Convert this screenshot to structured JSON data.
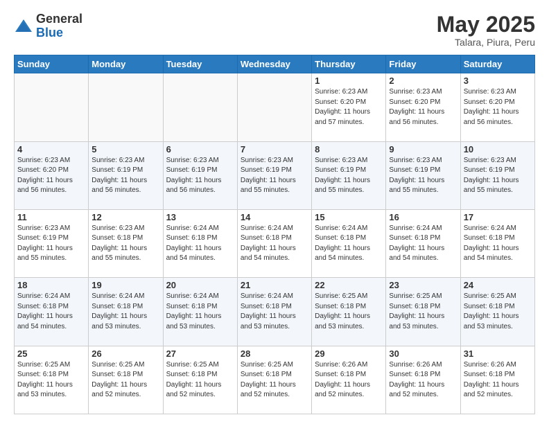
{
  "header": {
    "logo_general": "General",
    "logo_blue": "Blue",
    "month": "May 2025",
    "location": "Talara, Piura, Peru"
  },
  "days_of_week": [
    "Sunday",
    "Monday",
    "Tuesday",
    "Wednesday",
    "Thursday",
    "Friday",
    "Saturday"
  ],
  "weeks": [
    [
      {
        "day": "",
        "info": ""
      },
      {
        "day": "",
        "info": ""
      },
      {
        "day": "",
        "info": ""
      },
      {
        "day": "",
        "info": ""
      },
      {
        "day": "1",
        "info": "Sunrise: 6:23 AM\nSunset: 6:20 PM\nDaylight: 11 hours\nand 57 minutes."
      },
      {
        "day": "2",
        "info": "Sunrise: 6:23 AM\nSunset: 6:20 PM\nDaylight: 11 hours\nand 56 minutes."
      },
      {
        "day": "3",
        "info": "Sunrise: 6:23 AM\nSunset: 6:20 PM\nDaylight: 11 hours\nand 56 minutes."
      }
    ],
    [
      {
        "day": "4",
        "info": "Sunrise: 6:23 AM\nSunset: 6:20 PM\nDaylight: 11 hours\nand 56 minutes."
      },
      {
        "day": "5",
        "info": "Sunrise: 6:23 AM\nSunset: 6:19 PM\nDaylight: 11 hours\nand 56 minutes."
      },
      {
        "day": "6",
        "info": "Sunrise: 6:23 AM\nSunset: 6:19 PM\nDaylight: 11 hours\nand 56 minutes."
      },
      {
        "day": "7",
        "info": "Sunrise: 6:23 AM\nSunset: 6:19 PM\nDaylight: 11 hours\nand 55 minutes."
      },
      {
        "day": "8",
        "info": "Sunrise: 6:23 AM\nSunset: 6:19 PM\nDaylight: 11 hours\nand 55 minutes."
      },
      {
        "day": "9",
        "info": "Sunrise: 6:23 AM\nSunset: 6:19 PM\nDaylight: 11 hours\nand 55 minutes."
      },
      {
        "day": "10",
        "info": "Sunrise: 6:23 AM\nSunset: 6:19 PM\nDaylight: 11 hours\nand 55 minutes."
      }
    ],
    [
      {
        "day": "11",
        "info": "Sunrise: 6:23 AM\nSunset: 6:19 PM\nDaylight: 11 hours\nand 55 minutes."
      },
      {
        "day": "12",
        "info": "Sunrise: 6:23 AM\nSunset: 6:18 PM\nDaylight: 11 hours\nand 55 minutes."
      },
      {
        "day": "13",
        "info": "Sunrise: 6:24 AM\nSunset: 6:18 PM\nDaylight: 11 hours\nand 54 minutes."
      },
      {
        "day": "14",
        "info": "Sunrise: 6:24 AM\nSunset: 6:18 PM\nDaylight: 11 hours\nand 54 minutes."
      },
      {
        "day": "15",
        "info": "Sunrise: 6:24 AM\nSunset: 6:18 PM\nDaylight: 11 hours\nand 54 minutes."
      },
      {
        "day": "16",
        "info": "Sunrise: 6:24 AM\nSunset: 6:18 PM\nDaylight: 11 hours\nand 54 minutes."
      },
      {
        "day": "17",
        "info": "Sunrise: 6:24 AM\nSunset: 6:18 PM\nDaylight: 11 hours\nand 54 minutes."
      }
    ],
    [
      {
        "day": "18",
        "info": "Sunrise: 6:24 AM\nSunset: 6:18 PM\nDaylight: 11 hours\nand 54 minutes."
      },
      {
        "day": "19",
        "info": "Sunrise: 6:24 AM\nSunset: 6:18 PM\nDaylight: 11 hours\nand 53 minutes."
      },
      {
        "day": "20",
        "info": "Sunrise: 6:24 AM\nSunset: 6:18 PM\nDaylight: 11 hours\nand 53 minutes."
      },
      {
        "day": "21",
        "info": "Sunrise: 6:24 AM\nSunset: 6:18 PM\nDaylight: 11 hours\nand 53 minutes."
      },
      {
        "day": "22",
        "info": "Sunrise: 6:25 AM\nSunset: 6:18 PM\nDaylight: 11 hours\nand 53 minutes."
      },
      {
        "day": "23",
        "info": "Sunrise: 6:25 AM\nSunset: 6:18 PM\nDaylight: 11 hours\nand 53 minutes."
      },
      {
        "day": "24",
        "info": "Sunrise: 6:25 AM\nSunset: 6:18 PM\nDaylight: 11 hours\nand 53 minutes."
      }
    ],
    [
      {
        "day": "25",
        "info": "Sunrise: 6:25 AM\nSunset: 6:18 PM\nDaylight: 11 hours\nand 53 minutes."
      },
      {
        "day": "26",
        "info": "Sunrise: 6:25 AM\nSunset: 6:18 PM\nDaylight: 11 hours\nand 52 minutes."
      },
      {
        "day": "27",
        "info": "Sunrise: 6:25 AM\nSunset: 6:18 PM\nDaylight: 11 hours\nand 52 minutes."
      },
      {
        "day": "28",
        "info": "Sunrise: 6:25 AM\nSunset: 6:18 PM\nDaylight: 11 hours\nand 52 minutes."
      },
      {
        "day": "29",
        "info": "Sunrise: 6:26 AM\nSunset: 6:18 PM\nDaylight: 11 hours\nand 52 minutes."
      },
      {
        "day": "30",
        "info": "Sunrise: 6:26 AM\nSunset: 6:18 PM\nDaylight: 11 hours\nand 52 minutes."
      },
      {
        "day": "31",
        "info": "Sunrise: 6:26 AM\nSunset: 6:18 PM\nDaylight: 11 hours\nand 52 minutes."
      }
    ]
  ]
}
